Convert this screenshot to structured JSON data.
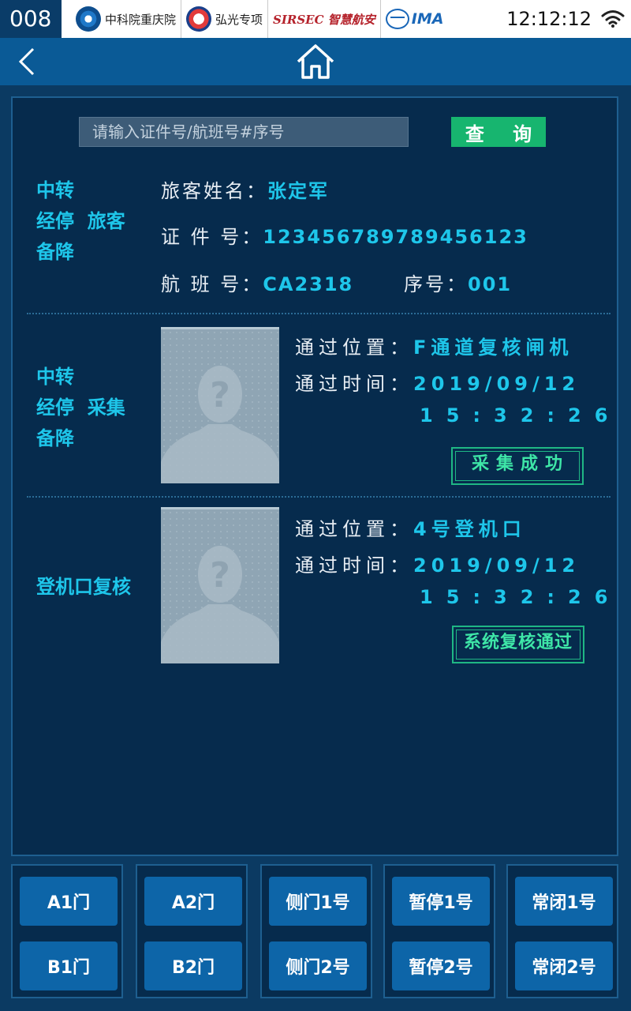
{
  "statusbar": {
    "device_id": "008",
    "logos": [
      {
        "name": "cas-logo",
        "text": "中科院重庆院"
      },
      {
        "name": "honggguang-logo",
        "text": "弘光专项"
      },
      {
        "name": "sirsec-logo",
        "text": "SIRSEC 智慧航安"
      },
      {
        "name": "ima-logo",
        "text": "IMA"
      }
    ],
    "time": "12:12:12"
  },
  "search": {
    "placeholder": "请输入证件号/航班号#序号",
    "query_label": "查 询"
  },
  "passenger": {
    "section_label_lines": [
      "中转",
      "经停  旅客",
      "备降"
    ],
    "name_label": "旅客姓名：",
    "name": "张定军",
    "id_label": "证 件 号：",
    "id_number": "123456789789456123",
    "flight_label": "航 班 号：",
    "flight": "CA2318",
    "seq_label": "序号：",
    "seq": "001"
  },
  "capture": {
    "section_label_lines": [
      "中转",
      "经停  采集",
      "备降"
    ],
    "location_label": "通过位置：",
    "location": "F通道复核闸机",
    "time_label": "通过时间：",
    "date": "2019/09/12",
    "time": "15:32:26",
    "status": "采集成功"
  },
  "gate_check": {
    "section_label": "登机口复核",
    "location_label": "通过位置：",
    "location": "4号登机口",
    "time_label": "通过时间：",
    "date": "2019/09/12",
    "time": "15:32:26",
    "status": "系统复核通过"
  },
  "bottom_buttons": [
    {
      "top": "A1门",
      "bottom": "B1门"
    },
    {
      "top": "A2门",
      "bottom": "B2门"
    },
    {
      "top": "侧门1号",
      "bottom": "侧门2号"
    },
    {
      "top": "暂停1号",
      "bottom": "暂停2号"
    },
    {
      "top": "常闭1号",
      "bottom": "常闭2号"
    }
  ],
  "colors": {
    "accent": "#1ec6ea",
    "success": "#17b56f",
    "panel": "#062b4d",
    "nav": "#0a5a96"
  }
}
